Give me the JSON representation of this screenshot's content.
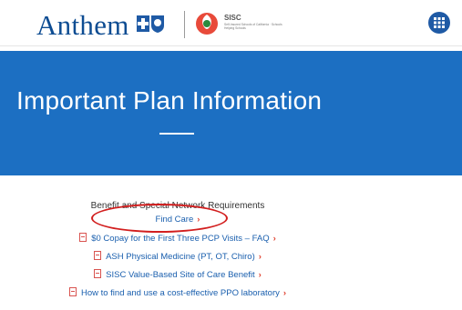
{
  "header": {
    "brand_name": "Anthem",
    "brand_mark_icon": "bcbs-cross-shield-icon",
    "partner_title": "SISC",
    "partner_subtitle": "Self-Insured Schools of California · Schools Helping Schools",
    "menu_icon": "grid-menu-icon",
    "accent_color": "#0d4c92"
  },
  "banner": {
    "title": "Important Plan Information",
    "background_color": "#1c6fc2"
  },
  "content": {
    "section_heading": "Benefit and Special Network Requirements",
    "links": [
      {
        "label": "Find Care",
        "has_pdf_icon": false,
        "chevron": "›"
      },
      {
        "label": "$0 Copay for the First Three PCP Visits – FAQ",
        "has_pdf_icon": true,
        "chevron": "›"
      },
      {
        "label": "ASH Physical Medicine (PT, OT, Chiro)",
        "has_pdf_icon": true,
        "chevron": "›"
      },
      {
        "label": "SISC Value-Based Site of Care Benefit",
        "has_pdf_icon": true,
        "chevron": "›"
      },
      {
        "label": "How to find and use a cost-effective PPO laboratory",
        "has_pdf_icon": true,
        "chevron": "›"
      }
    ],
    "link_color": "#1a5fae",
    "chevron_color": "#e0412f",
    "highlight_color": "#d21e1e"
  }
}
